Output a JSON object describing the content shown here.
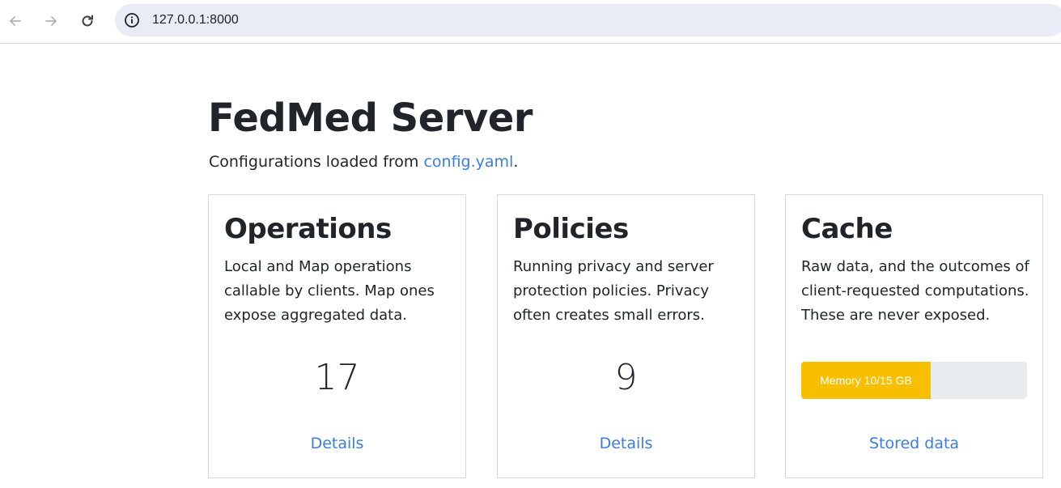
{
  "browser": {
    "url": "127.0.0.1:8000",
    "back_icon": "arrow-left-icon",
    "forward_icon": "arrow-right-icon",
    "reload_icon": "reload-icon",
    "site_info_icon": "info-icon"
  },
  "page": {
    "title": "FedMed Server",
    "subtitle_prefix": "Configurations loaded from ",
    "subtitle_link": "config.yaml",
    "subtitle_suffix": "."
  },
  "cards": [
    {
      "title": "Operations",
      "text": "Local and Map operations callable by clients. Map ones expose aggregated data.",
      "count": "17",
      "link": "Details"
    },
    {
      "title": "Policies",
      "text": "Running privacy and server protection policies. Privacy often creates small errors.",
      "count": "9",
      "link": "Details"
    },
    {
      "title": "Cache",
      "text": "Raw data, and the outcomes of client-requested computations. These are never exposed.",
      "progress_label": "Memory 10/15 GB",
      "progress_fraction": 0.573,
      "link": "Stored data"
    }
  ],
  "colors": {
    "link": "#3b7ddd",
    "progress_fill": "#f8bf00",
    "progress_track": "#e9ecef"
  }
}
